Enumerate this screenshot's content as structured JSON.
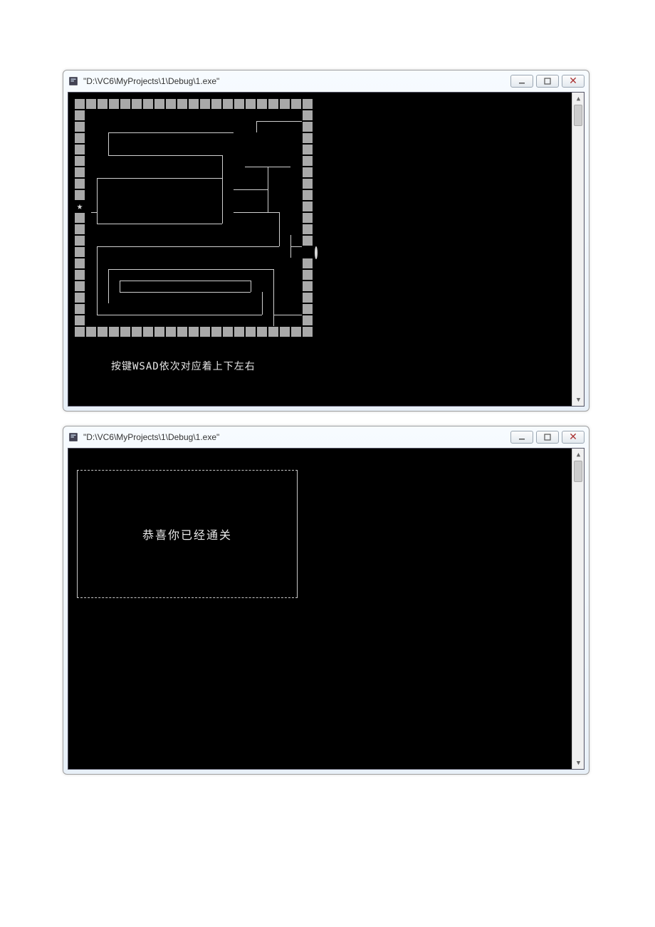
{
  "window1": {
    "title": "\"D:\\VC6\\MyProjects\\1\\Debug\\1.exe\"",
    "help_text": "按键WSAD依次对应着上下左右",
    "maze": {
      "player_glyph": "★",
      "goal_glyph": "○",
      "wall_glyph": "■",
      "grid_size": [
        21,
        21
      ],
      "outer_wall_color": "#a9a9a9",
      "player_pos": [
        9,
        0
      ],
      "goal_pos": [
        13,
        21
      ]
    }
  },
  "window2": {
    "title": "\"D:\\VC6\\MyProjects\\1\\Debug\\1.exe\"",
    "congrats_text": "恭喜你已经通关"
  },
  "controls": {
    "minimize_tip": "Minimize",
    "maximize_tip": "Maximize",
    "close_tip": "Close"
  }
}
